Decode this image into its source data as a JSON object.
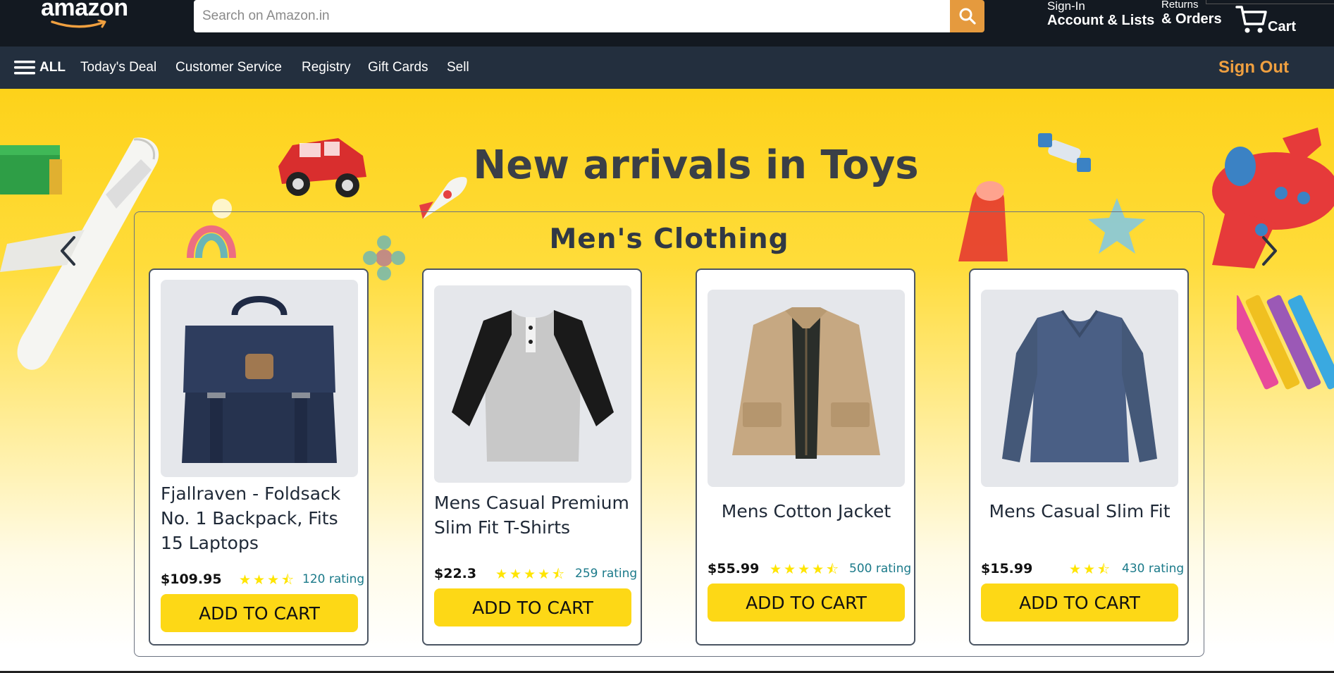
{
  "header": {
    "logo_text": "amazon",
    "search": {
      "placeholder": "Search on Amazon.in",
      "value": "",
      "icon": "search-icon"
    },
    "account": {
      "line1": "Sign-In",
      "line2": "Account & Lists"
    },
    "orders": {
      "line1": "Returns",
      "line2": "& Orders"
    },
    "cart": {
      "label": "Cart",
      "icon": "cart-icon"
    }
  },
  "subnav": {
    "all_label": "ALL",
    "items": [
      "Today's Deal",
      "Customer Service",
      "Registry",
      "Gift Cards",
      "Sell"
    ],
    "sign_out": "Sign Out"
  },
  "hero": {
    "banner_title": "New arrivals in Toys",
    "section_title": "Men's Clothing",
    "prev_icon": "chevron-left-icon",
    "next_icon": "chevron-right-icon"
  },
  "products": [
    {
      "title": "Fjallraven - Foldsack No. 1 Backpack, Fits 15 Laptops",
      "price": "$109.95",
      "stars": 3.5,
      "rating_text": "120 rating",
      "button": "ADD TO CART",
      "image": "backpack-image"
    },
    {
      "title": "Mens Casual Premium Slim Fit T-Shirts",
      "price": "$22.3",
      "stars": 4.5,
      "rating_text": "259 rating",
      "button": "ADD TO CART",
      "image": "tshirt-image"
    },
    {
      "title": "Mens Cotton Jacket",
      "price": "$55.99",
      "stars": 4.5,
      "rating_text": "500 rating",
      "button": "ADD TO CART",
      "image": "jacket-image"
    },
    {
      "title": "Mens Casual Slim Fit",
      "price": "$15.99",
      "stars": 2.5,
      "rating_text": "430 rating",
      "button": "ADD TO CART",
      "image": "longsleeve-image"
    }
  ],
  "colors": {
    "header_bg": "#131921",
    "subnav_bg": "#232f3e",
    "accent_orange": "#e59a3e",
    "sign_out": "#f0a040",
    "button_yellow": "#fdd816",
    "star_yellow": "#ffe500",
    "rating_teal": "#1b7a8a"
  }
}
